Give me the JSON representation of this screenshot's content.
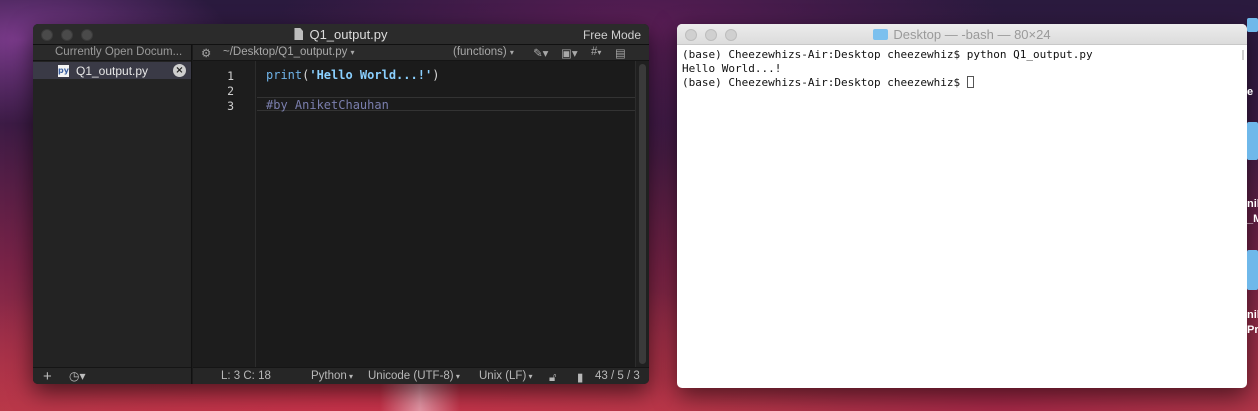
{
  "editor": {
    "title": "Q1_output.py",
    "mode": "Free Mode",
    "sidebar": {
      "header": "Currently Open Docum...",
      "files": [
        {
          "name": "Q1_output.py",
          "icon": "python-file-icon"
        }
      ]
    },
    "navbar": {
      "path": "~/Desktop/Q1_output.py",
      "path_arrow": "▾",
      "functions": "(functions)",
      "functions_arrow": "▾",
      "hash": "#"
    },
    "gutter": [
      "1",
      "2",
      "3"
    ],
    "code": {
      "line1_kw": "print",
      "line1_open": "(",
      "line1_str": "'Hello World...!'",
      "line1_close": ")",
      "line3": "#by AniketChauhan"
    },
    "status": {
      "position": "L: 3 C: 18",
      "language": "Python",
      "encoding": "Unicode (UTF-8)",
      "line_endings": "Unix (LF)",
      "counts": "43 / 5 / 3"
    },
    "footer": {
      "add_label": "+",
      "history_label": "◷▾"
    }
  },
  "terminal": {
    "title": "Desktop — -bash — 80×24",
    "lines": [
      "(base) Cheezewhizs-Air:Desktop cheezewhiz$ python Q1_output.py",
      "Hello World...!",
      "(base) Cheezewhizs-Air:Desktop cheezewhiz$ "
    ]
  },
  "desktop": {
    "edge_labels": [
      "e",
      "nik",
      "_M",
      "nik",
      "Pr"
    ]
  },
  "colors": {
    "editor_bg": "#1b1b1b",
    "keyword": "#6fb3e8",
    "string": "#8ad0ff",
    "comment": "#7b7fae",
    "terminal_bg": "#ffffff",
    "selection": "#3a3a46"
  }
}
